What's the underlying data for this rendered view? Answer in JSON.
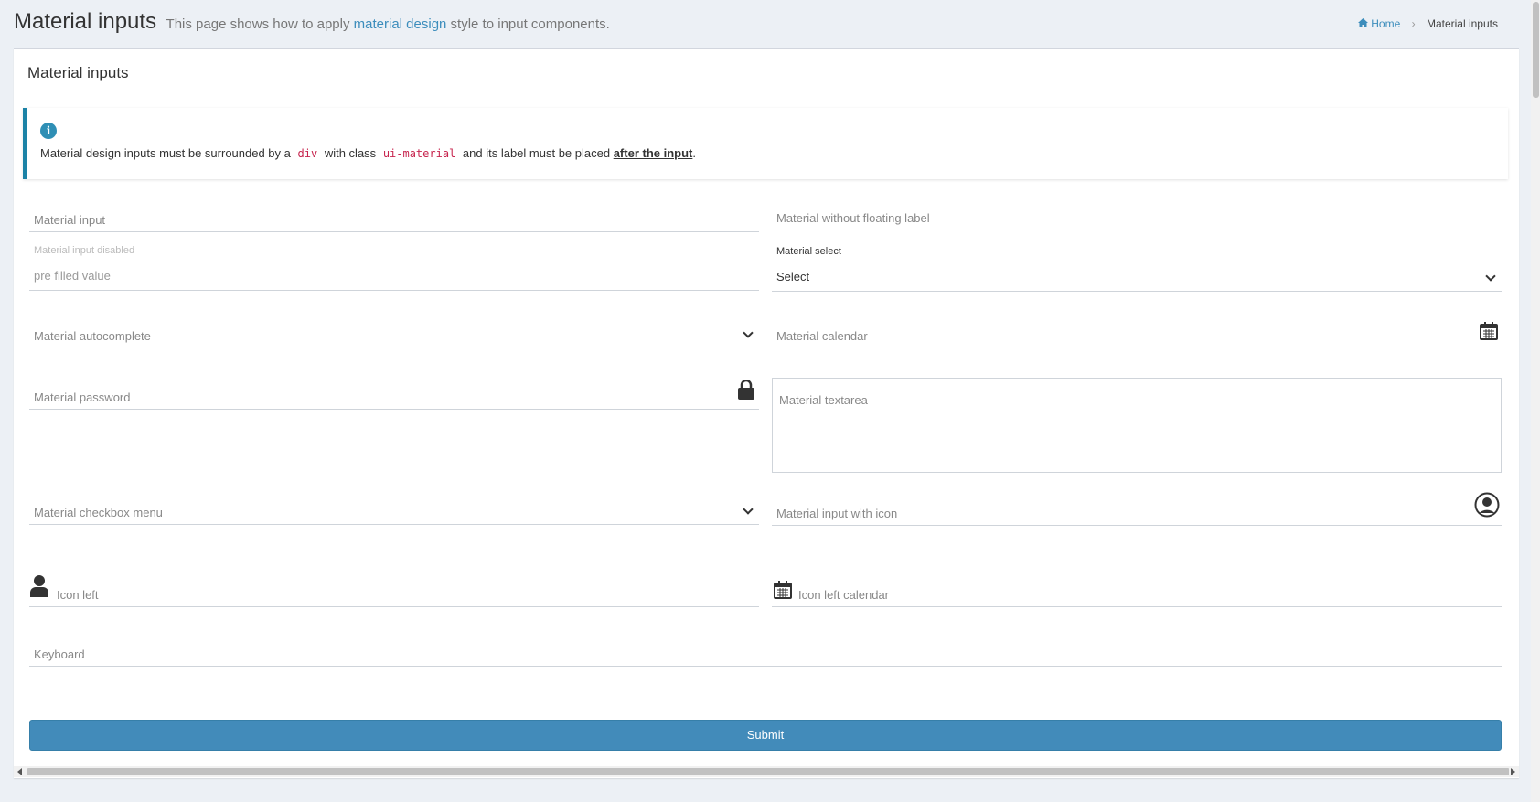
{
  "header": {
    "title": "Material inputs",
    "subtitle_pre": "This page shows how to apply",
    "subtitle_link": "material design",
    "subtitle_post": "style to input components."
  },
  "breadcrumb": {
    "home": "Home",
    "current": "Material inputs"
  },
  "box": {
    "title": "Material inputs"
  },
  "callout": {
    "text1": "Material design inputs must be surrounded by a",
    "code1": "div",
    "text2": "with class",
    "code2": "ui-material",
    "text3": "and its label must be placed",
    "bold": "after the input",
    "text4": "."
  },
  "fields": {
    "material_input": "Material input",
    "without_floating": "Material without floating label",
    "disabled_label": "Material input disabled",
    "disabled_value": "pre filled value",
    "select_label": "Material select",
    "select_value": "Select",
    "autocomplete": "Material autocomplete",
    "calendar": "Material calendar",
    "password": "Material password",
    "textarea": "Material textarea",
    "checkbox_menu": "Material checkbox menu",
    "input_with_icon": "Material input with icon",
    "icon_left": "Icon left",
    "icon_left_calendar": "Icon left calendar",
    "keyboard": "Keyboard"
  },
  "submit_label": "Submit",
  "icons": {
    "info": "info-circle-icon",
    "home": "home-icon",
    "chevron": "chevron-down-icon",
    "calendar": "calendar-icon",
    "lock": "lock-icon",
    "user_circle": "user-circle-icon",
    "user": "user-icon"
  },
  "colors": {
    "primary": "#428bba",
    "link": "#3c8dbc",
    "code": "#c7254e",
    "callout_border": "#1b82a6"
  }
}
